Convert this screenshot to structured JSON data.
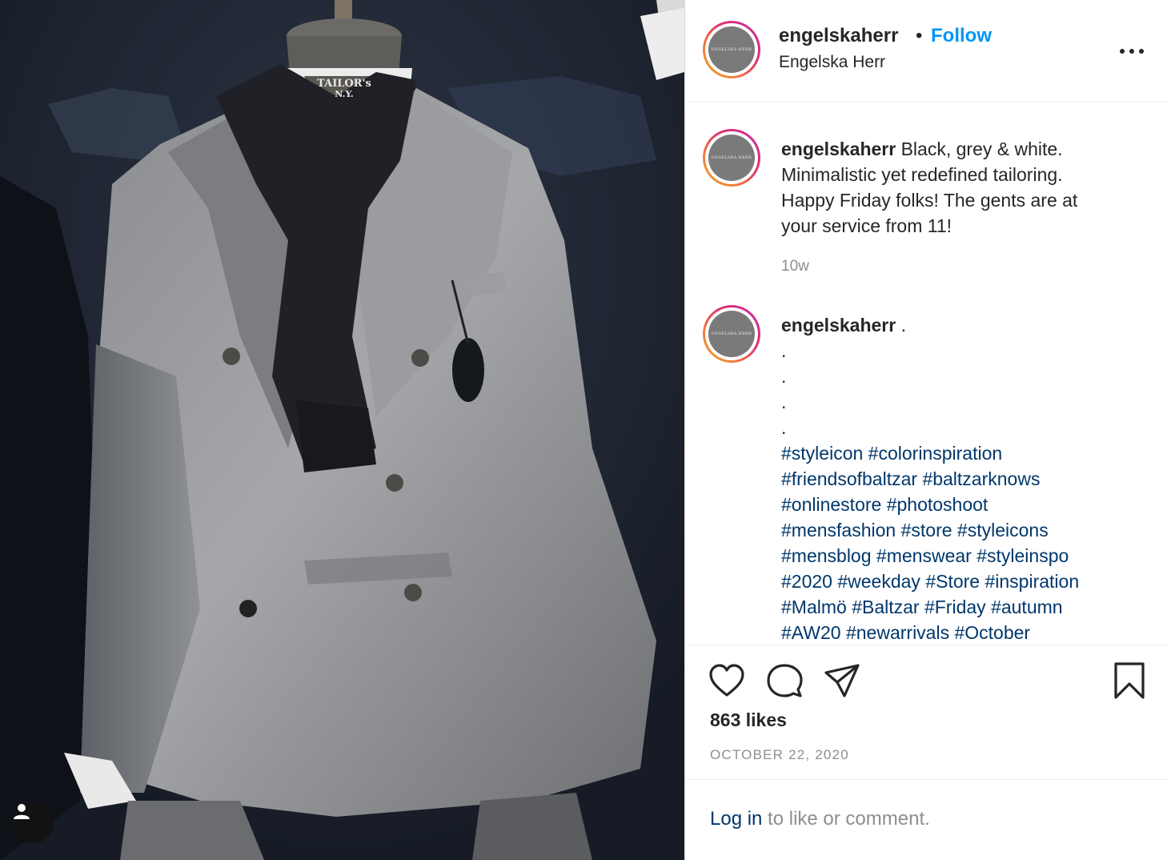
{
  "post": {
    "username": "engelskaherr",
    "dot": "•",
    "follow_label": "Follow",
    "subtitle": "Engelska Herr",
    "avatar_text": "ENGELSKA HERR",
    "caption": {
      "username": "engelskaherr",
      "text_lines": [
        "Black, grey & white.",
        "Minimalistic yet redefined tailoring.",
        "Happy Friday folks! The gents are at",
        "your service from 11!"
      ],
      "time": "10w"
    },
    "comment": {
      "username": "engelskaherr",
      "first": ".",
      "dots": [
        ".",
        ".",
        ".",
        "."
      ],
      "hashtag_lines": [
        [
          "#styleicon",
          "#colorinspiration"
        ],
        [
          "#friendsofbaltzar",
          "#baltzarknows"
        ],
        [
          "#onlinestore",
          "#photoshoot"
        ],
        [
          "#mensfashion",
          "#store",
          "#styleicons"
        ],
        [
          "#mensblog",
          "#menswear",
          "#styleinspo"
        ],
        [
          "#2020",
          "#weekday",
          "#Store",
          "#inspiration"
        ],
        [
          "#Malmö",
          "#Baltzar",
          "#Friday",
          "#autumn"
        ],
        [
          "#AW20",
          "#newarrivals",
          "#October"
        ]
      ]
    },
    "likes": "863 likes",
    "date": "OCTOBER 22, 2020",
    "footer": {
      "login": "Log in",
      "rest": " to like or comment."
    },
    "photo": {
      "mannequin_label": [
        "TAILOR's",
        "N.Y."
      ]
    }
  },
  "icons": {
    "like": "heart-icon",
    "comment": "comment-icon",
    "share": "share-icon",
    "save": "bookmark-icon",
    "more": "more-icon",
    "user_tag": "user-icon"
  },
  "colors": {
    "follow": "#0095f6",
    "hashtag": "#00376b",
    "secondary_text": "#8e8e8e"
  }
}
